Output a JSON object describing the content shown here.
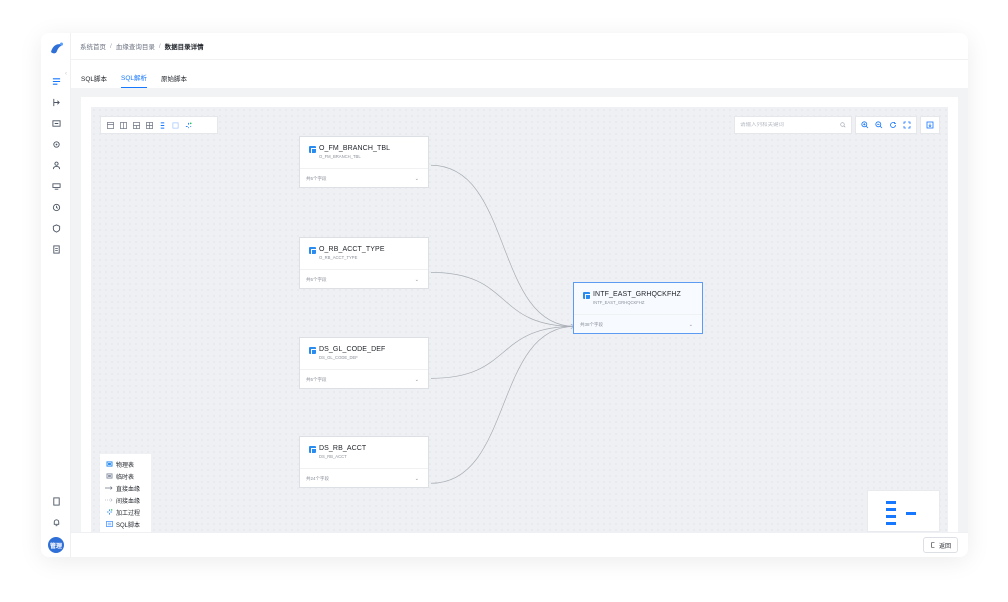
{
  "breadcrumb": {
    "home": "系统首页",
    "separator": "/",
    "parent": "血缘查询目录",
    "current": "数据目录详情"
  },
  "tabs": [
    {
      "label": "SQL脚本",
      "active": false
    },
    {
      "label": "SQL解析",
      "active": true
    },
    {
      "label": "原始脚本",
      "active": false
    }
  ],
  "search": {
    "placeholder": "请输入列和关键词",
    "value": ""
  },
  "nodes": [
    {
      "title": "O_FM_BRANCH_TBL",
      "subtitle": "O_FM_BRANCH_TBL",
      "fields": "共5个字段"
    },
    {
      "title": "O_RB_ACCT_TYPE",
      "subtitle": "O_RB_ACCT_TYPE",
      "fields": "共5个字段"
    },
    {
      "title": "DS_GL_CODE_DEF",
      "subtitle": "DS_GL_CODE_DEF",
      "fields": "共5个字段"
    },
    {
      "title": "DS_RB_ACCT",
      "subtitle": "DS_RB_ACCT",
      "fields": "共24个字段"
    },
    {
      "title": "INTF_EAST_GRHQCKFHZ",
      "subtitle": "INTF_EAST_GRHQCKFHZ",
      "fields": "共38个字段"
    }
  ],
  "legend": {
    "physical_table": "物理表",
    "temp_table": "临时表",
    "direct_lineage": "直接血缘",
    "indirect_lineage": "间接血缘",
    "process": "加工过程",
    "sql_script": "SQL脚本"
  },
  "user": {
    "avatar_text": "管理"
  },
  "back_button": "返回",
  "colors": {
    "accent": "#1677ff",
    "table_icon": "#2b8cf0",
    "avatar": "#2f6fd8"
  }
}
